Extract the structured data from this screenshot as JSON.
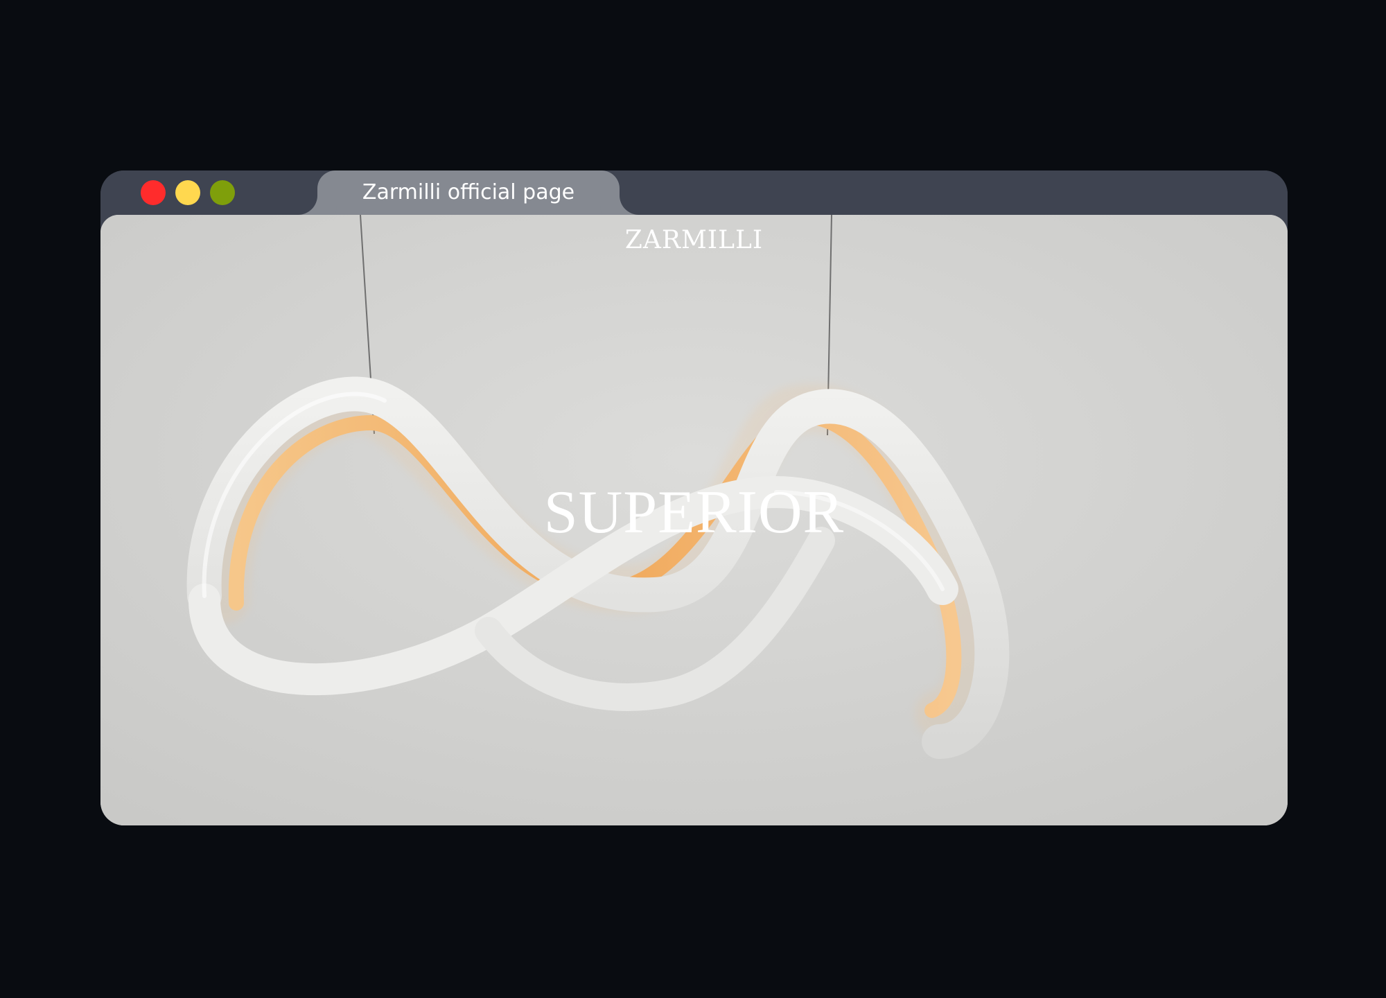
{
  "window": {
    "controls": [
      {
        "name": "close",
        "color": "#ff2c2c"
      },
      {
        "name": "minimize",
        "color": "#ffd84f"
      },
      {
        "name": "maximize",
        "color": "#7f9f0b"
      }
    ],
    "tab_title": "Zarmilli official page"
  },
  "page": {
    "brand": "ZARMILLI",
    "hero_heading": "SUPERIOR"
  },
  "colors": {
    "backdrop": "#090c11",
    "title_bar": "#3f4451",
    "active_tab": "#858991",
    "page_background": "#d6d6d4",
    "lamp_glow": "#f0a85a"
  }
}
